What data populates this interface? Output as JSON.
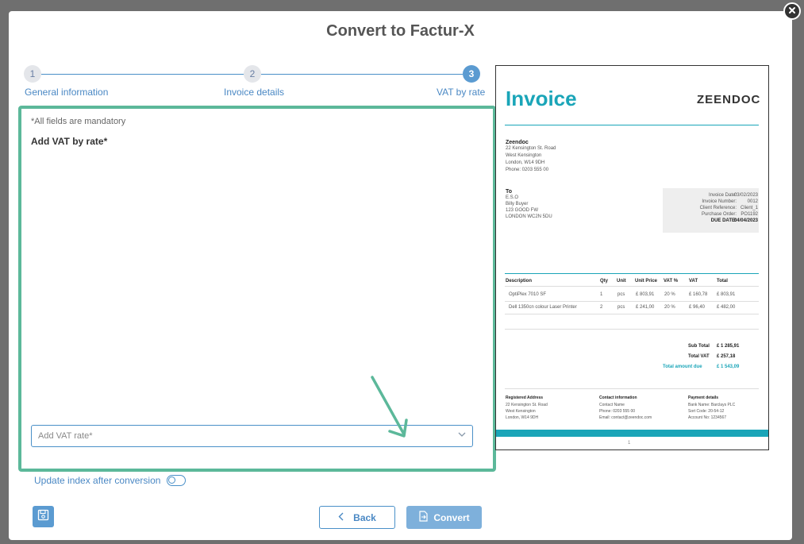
{
  "modal": {
    "title": "Convert to Factur-X"
  },
  "stepper": {
    "steps": [
      {
        "number": "1",
        "label": "General information"
      },
      {
        "number": "2",
        "label": "Invoice details"
      },
      {
        "number": "3",
        "label": "VAT by rate"
      }
    ],
    "active_step": 3
  },
  "form": {
    "mandatory_note": "*All fields are mandatory",
    "section_title": "Add VAT by rate*",
    "vat_select_placeholder": "Add VAT rate*"
  },
  "toggle": {
    "label": "Update index after conversion",
    "checked": false
  },
  "footer": {
    "back_label": "Back",
    "convert_label": "Convert"
  },
  "invoice_preview": {
    "title": "Invoice",
    "logo": "ZEENDOC",
    "seller": {
      "name": "Zeendoc",
      "lines": [
        "22 Kensington St. Road",
        "West Kensington",
        "London, W14 9DH",
        "Phone: 0203 555 00"
      ]
    },
    "buyer": {
      "label": "To",
      "lines": [
        "E.S.O",
        "Billy Buyer",
        "123 GOOD FW",
        "LONDON WC2N 5DU"
      ]
    },
    "meta": [
      {
        "key": "Invoice Date:",
        "value": "03/02/2023"
      },
      {
        "key": "Invoice Number:",
        "value": "0012"
      },
      {
        "key": "Client Reference:",
        "value": "Client_1"
      },
      {
        "key": "Purchase Order:",
        "value": "PO1192"
      },
      {
        "key": "DUE DATE:",
        "value": "04/04/2023"
      }
    ],
    "table": {
      "headers": [
        "Description",
        "Qty",
        "Unit",
        "Unit Price",
        "VAT %",
        "VAT",
        "Total"
      ],
      "rows": [
        [
          "OptiPlex 7010 SF",
          "1",
          "pcs",
          "£ 803,91",
          "20 %",
          "£ 160,78",
          "£ 803,91"
        ],
        [
          "Dell 1350cn colour Laser Printer",
          "2",
          "pcs",
          "£ 241,00",
          "20 %",
          "£ 96,40",
          "£ 482,00"
        ]
      ]
    },
    "totals": [
      {
        "label": "Sub Total",
        "value": "£ 1 285,91"
      },
      {
        "label": "Total VAT",
        "value": "£ 257,18"
      },
      {
        "label": "Total amount due",
        "value": "£ 1 543,09"
      }
    ],
    "footer_cols": [
      {
        "title": "Registered Address",
        "lines": [
          "22 Kensington St. Road",
          "West Kensington",
          "London, W14 9DH"
        ]
      },
      {
        "title": "Contact information",
        "lines": [
          "Contact Name",
          "Phone: 0203 555 00",
          "Email: contact@zeendoc.com"
        ]
      },
      {
        "title": "Payment details",
        "lines": [
          "Bank Name: Barclays PLC",
          "Sort Code: 20-54-12",
          "Account No: 1234567"
        ]
      }
    ],
    "page_number": "1"
  },
  "colors": {
    "accent": "#5b9bd1",
    "form_border": "#5cb89a",
    "invoice_teal": "#1aa5b8"
  }
}
